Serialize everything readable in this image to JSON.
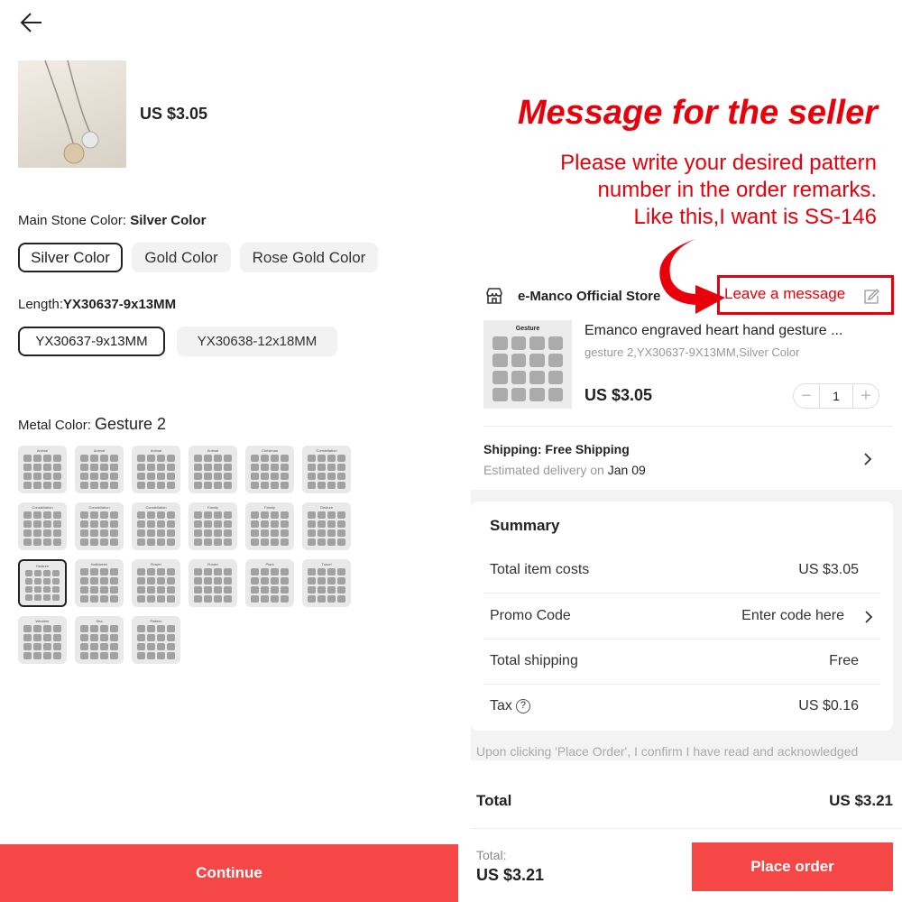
{
  "left": {
    "price": "US $3.05",
    "main_stone": {
      "label": "Main Stone Color:",
      "value": "Silver Color",
      "options": [
        "Silver Color",
        "Gold Color",
        "Rose Gold Color"
      ],
      "selected": 0
    },
    "length": {
      "label": "Length:",
      "value": "YX30637-9x13MM",
      "options": [
        "YX30637-9x13MM",
        "YX30638-12x18MM"
      ],
      "selected": 0
    },
    "metal": {
      "label": "Metal Color:",
      "value": "Gesture 2",
      "tiles": [
        "Animal",
        "Animal",
        "Animal",
        "Animal",
        "Christmas",
        "Constellation",
        "Constellation",
        "Constellation",
        "Constellation",
        "Family",
        "Family",
        "Gesture",
        "Gesture",
        "Halloween",
        "Flower",
        "Flower",
        "Plant",
        "Travel",
        "Weather",
        "Sea",
        "Pattern"
      ],
      "selected": 12
    },
    "continue_label": "Continue"
  },
  "overlay": {
    "headline": "Message for the seller",
    "note_lines": [
      "Please write your desired pattern",
      "number in the order remarks.",
      "Like this,I want is SS-146"
    ]
  },
  "order": {
    "store_name": "e-Manco Official Store",
    "leave_message": "Leave a message",
    "product": {
      "image_title": "Gesture",
      "name": "Emanco engraved heart hand gesture ...",
      "variant": "gesture 2,YX30637-9X13MM,Silver Color",
      "price": "US $3.05",
      "quantity": "1"
    },
    "shipping": {
      "title": "Shipping: Free Shipping",
      "delivery_prefix": "Estimated delivery on",
      "delivery_date": "Jan 09"
    },
    "summary": {
      "title": "Summary",
      "rows": [
        {
          "label": "Total item costs",
          "value": "US $3.05"
        },
        {
          "label": "Promo Code",
          "value": "Enter code here"
        },
        {
          "label": "Total shipping",
          "value": "Free"
        },
        {
          "label": "Tax",
          "value": "US $0.16"
        }
      ]
    },
    "disclaimer": "Upon clicking 'Place Order', I confirm I have read and acknowledged",
    "total_label": "Total",
    "total_value": "US $3.21",
    "footer_total_label": "Total:",
    "footer_total_value": "US $3.21",
    "place_order_label": "Place order"
  },
  "colors": {
    "accent": "#f64747",
    "annotation_red": "#e8000b"
  }
}
